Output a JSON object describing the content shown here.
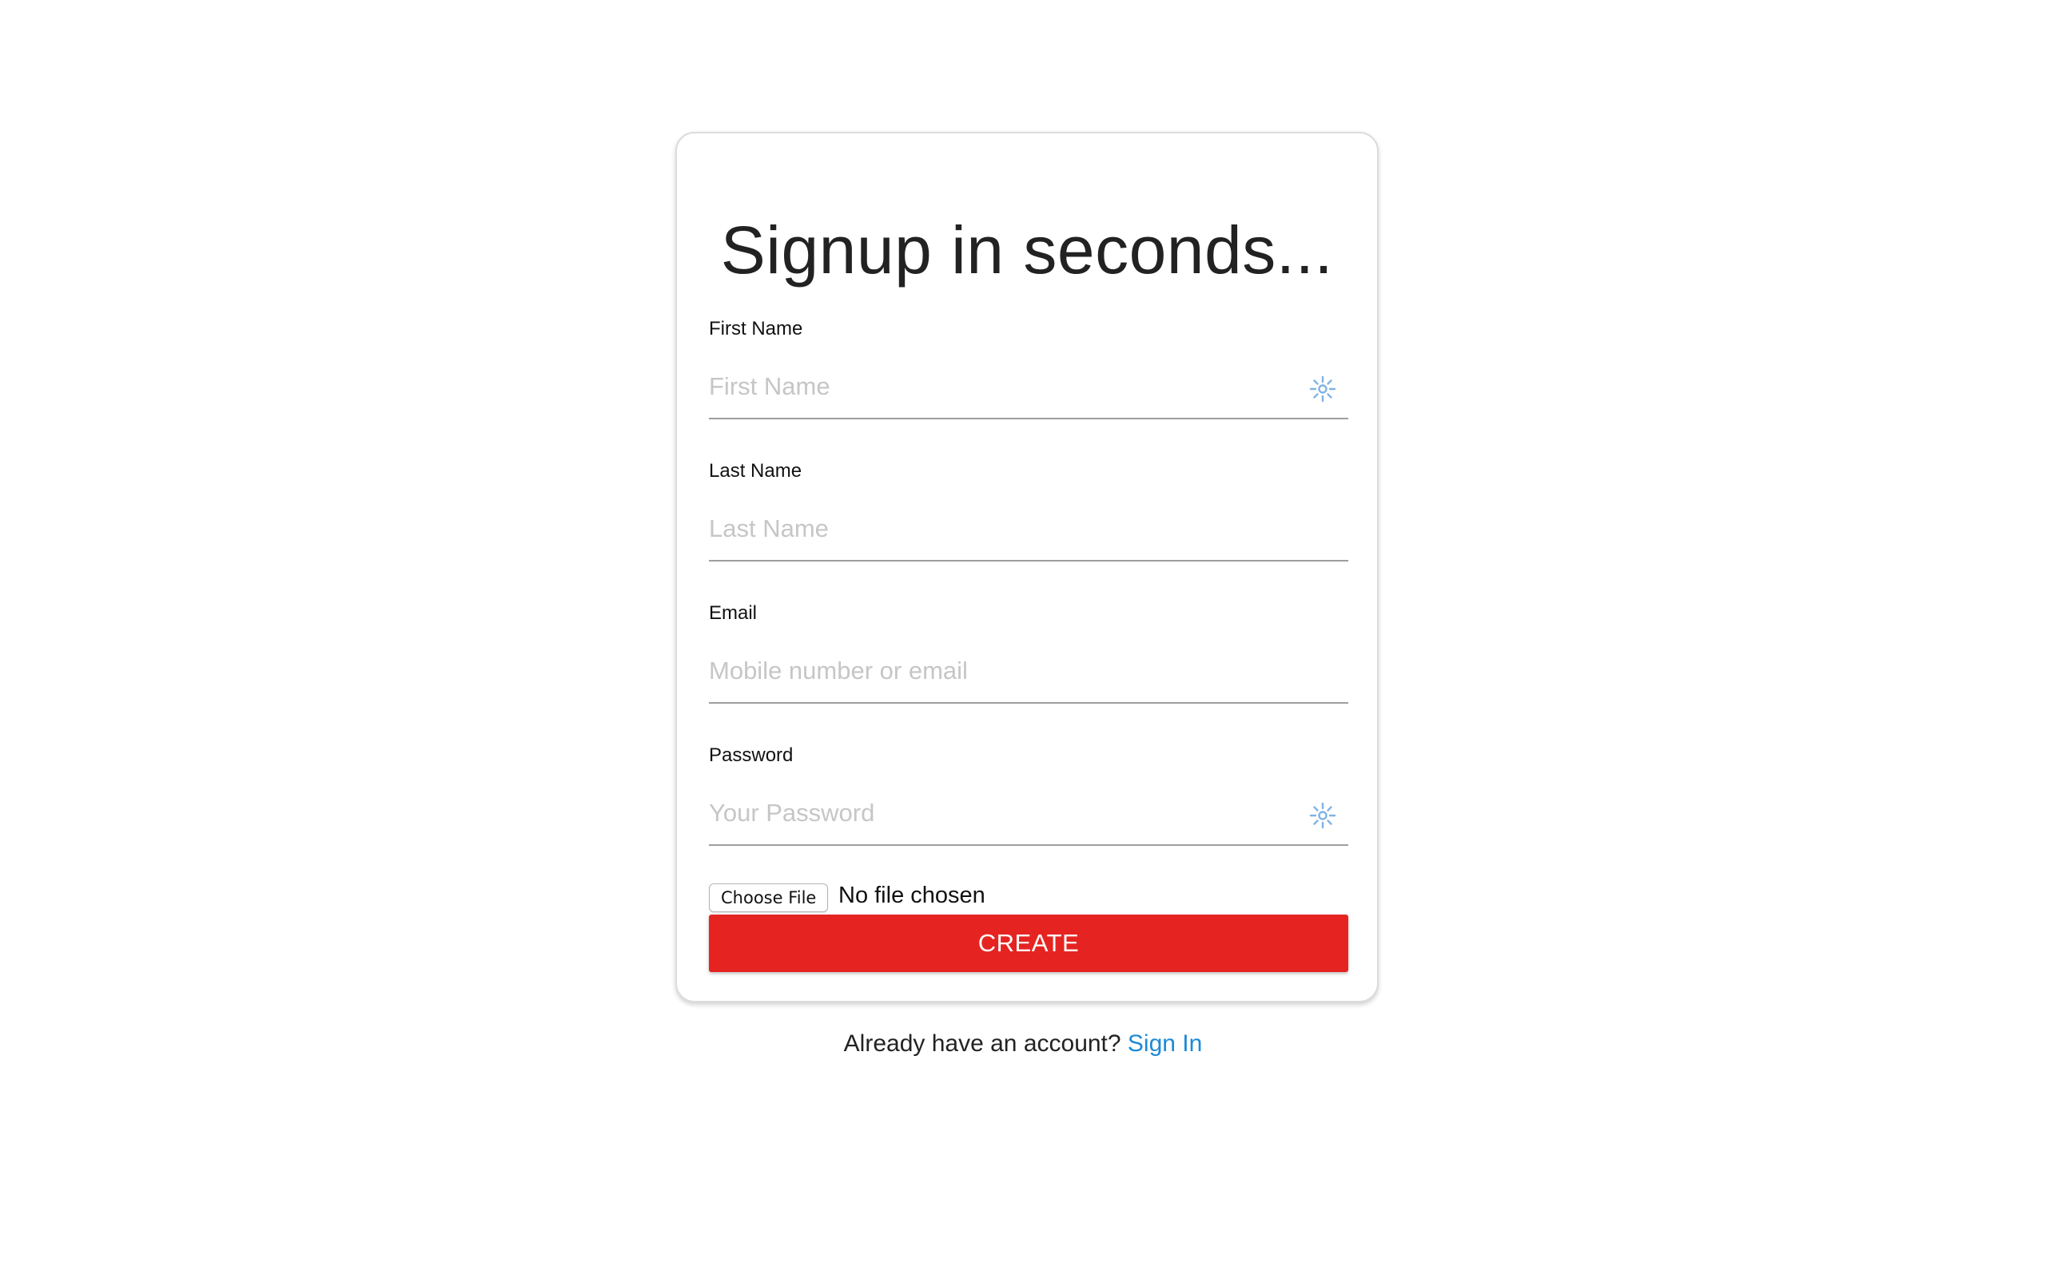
{
  "form": {
    "title": "Signup in seconds...",
    "fields": [
      {
        "label": "First Name",
        "placeholder": "First Name",
        "value": ""
      },
      {
        "label": "Last Name",
        "placeholder": "Last Name",
        "value": ""
      },
      {
        "label": "Email",
        "placeholder": "Mobile number or email",
        "value": ""
      },
      {
        "label": "Password",
        "placeholder": "Your Password",
        "value": ""
      }
    ],
    "file": {
      "button_label": "Choose File",
      "status": "No file chosen"
    },
    "submit_label": "CREATE"
  },
  "footer": {
    "prompt": "Already have an account?",
    "link_label": "Sign In"
  },
  "colors": {
    "primary_button": "#e52421",
    "link": "#1c8ad6",
    "autofill_icon": "#7fb3e6"
  },
  "icons": {
    "autofill": "autofill-sparkle-icon"
  }
}
